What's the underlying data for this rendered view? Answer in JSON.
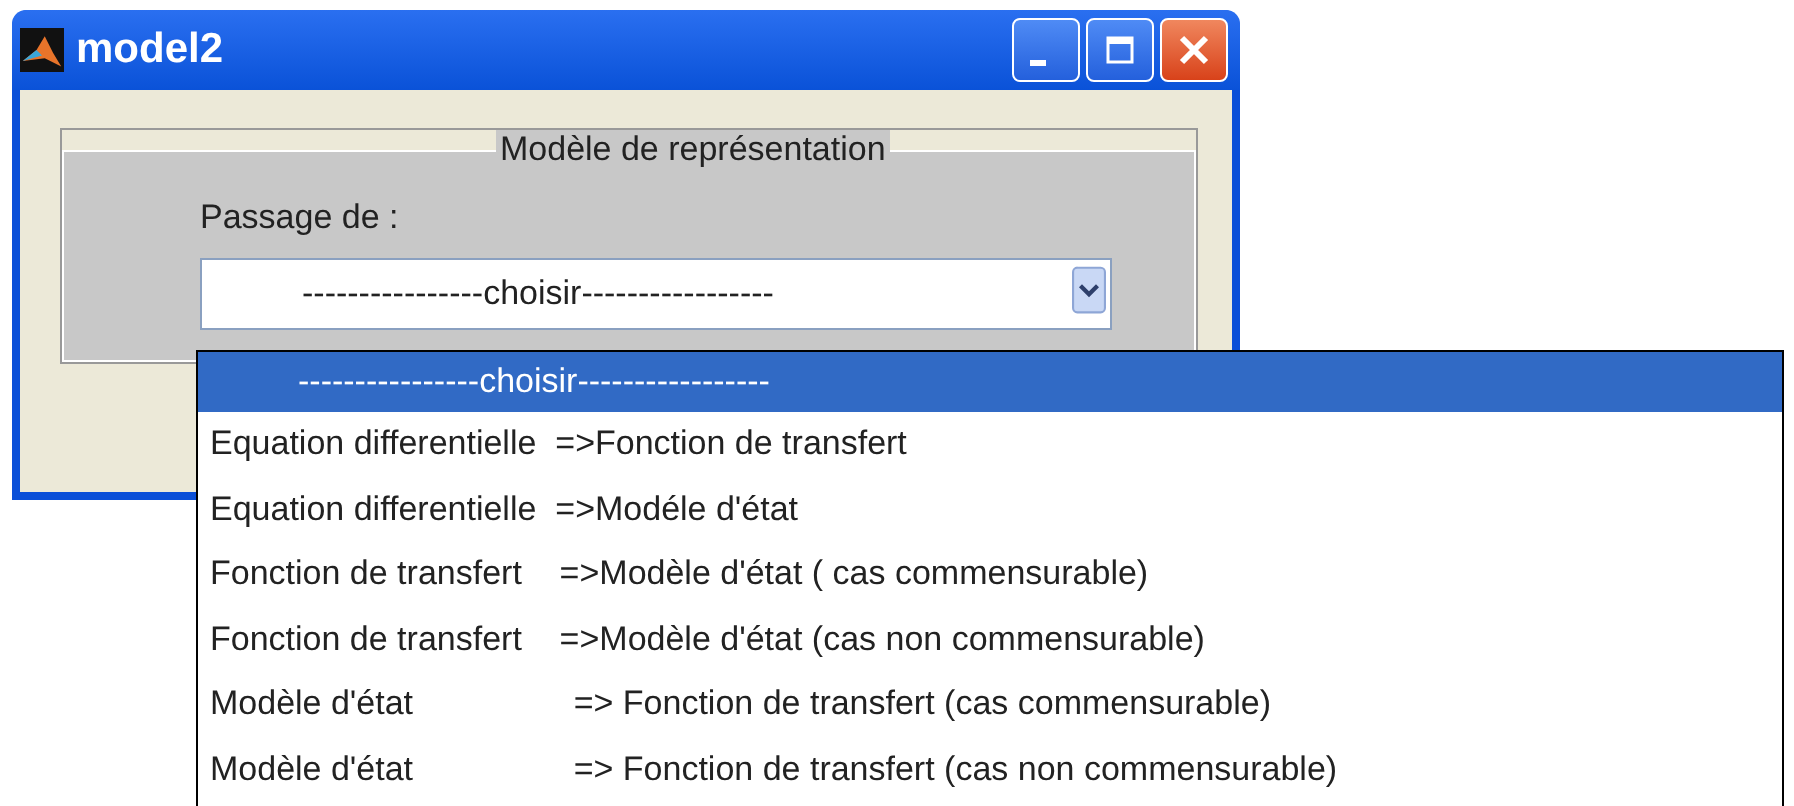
{
  "window": {
    "title": "model2"
  },
  "group": {
    "title": "Modèle de représentation"
  },
  "field_label": "Passage de :",
  "dropdown": {
    "value": "----------------choisir-----------------"
  },
  "options": [
    {
      "label": "----------------choisir-----------------",
      "selected": true
    },
    {
      "label": "Equation differentielle  =>Fonction de transfert",
      "selected": false
    },
    {
      "label": "Equation differentielle  =>Modéle d'état",
      "selected": false
    },
    {
      "label": "Fonction de transfert    =>Modèle d'état ( cas commensurable)",
      "selected": false
    },
    {
      "label": "Fonction de transfert    =>Modèle d'état (cas non commensurable)",
      "selected": false
    },
    {
      "label": "Modèle d'état                 => Fonction de transfert (cas commensurable)",
      "selected": false
    },
    {
      "label": "Modèle d'état                 => Fonction de transfert (cas non commensurable)",
      "selected": false
    }
  ]
}
